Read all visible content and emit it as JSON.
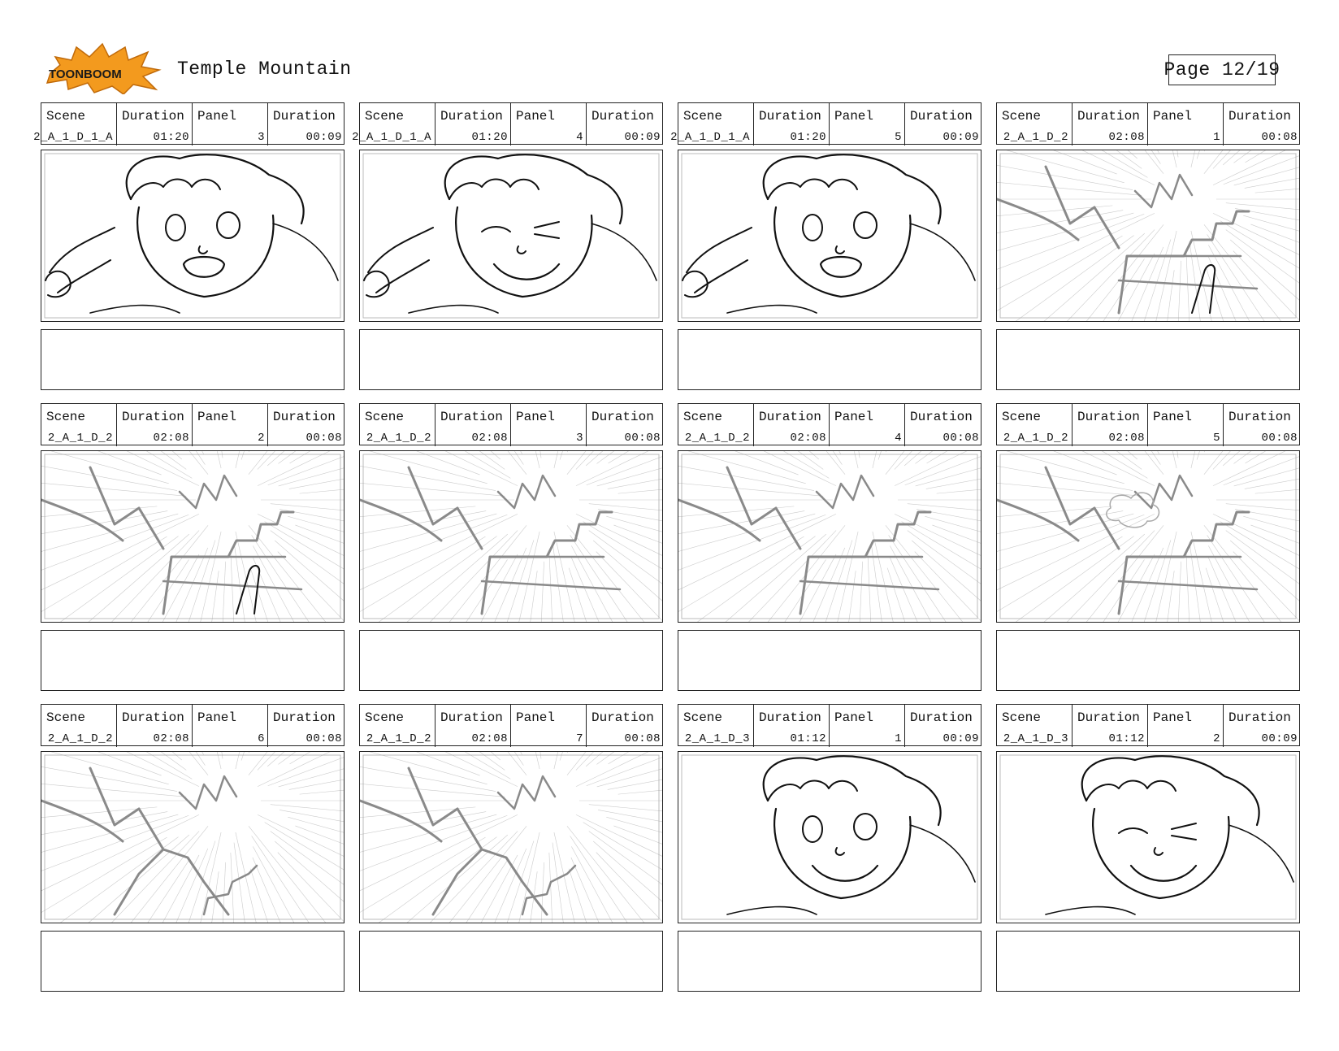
{
  "header": {
    "logo_text": "TOONBOOM",
    "title": "Temple Mountain",
    "page_label": "Page",
    "page_number": "12/19"
  },
  "labels": {
    "scene": "Scene",
    "duration": "Duration",
    "panel": "Panel"
  },
  "panels": [
    {
      "scene": "2_A_1_D_1_A",
      "scene_duration": "01:20",
      "panel": "3",
      "panel_duration": "00:09",
      "sketch": "girl-running-face"
    },
    {
      "scene": "2_A_1_D_1_A",
      "scene_duration": "01:20",
      "panel": "4",
      "panel_duration": "00:09",
      "sketch": "girl-determined-face"
    },
    {
      "scene": "2_A_1_D_1_A",
      "scene_duration": "01:20",
      "panel": "5",
      "panel_duration": "00:09",
      "sketch": "girl-shouting-face"
    },
    {
      "scene": "2_A_1_D_2",
      "scene_duration": "02:08",
      "panel": "1",
      "panel_duration": "00:08",
      "sketch": "temple-mountain-pointing"
    },
    {
      "scene": "2_A_1_D_2",
      "scene_duration": "02:08",
      "panel": "2",
      "panel_duration": "00:08",
      "sketch": "temple-mountain-pointing"
    },
    {
      "scene": "2_A_1_D_2",
      "scene_duration": "02:08",
      "panel": "3",
      "panel_duration": "00:08",
      "sketch": "temple-mountain"
    },
    {
      "scene": "2_A_1_D_2",
      "scene_duration": "02:08",
      "panel": "4",
      "panel_duration": "00:08",
      "sketch": "temple-mountain"
    },
    {
      "scene": "2_A_1_D_2",
      "scene_duration": "02:08",
      "panel": "5",
      "panel_duration": "00:08",
      "sketch": "temple-mountain-far"
    },
    {
      "scene": "2_A_1_D_2",
      "scene_duration": "02:08",
      "panel": "6",
      "panel_duration": "00:08",
      "sketch": "temple-cliff"
    },
    {
      "scene": "2_A_1_D_2",
      "scene_duration": "02:08",
      "panel": "7",
      "panel_duration": "00:08",
      "sketch": "temple-cliff"
    },
    {
      "scene": "2_A_1_D_3",
      "scene_duration": "01:12",
      "panel": "1",
      "panel_duration": "00:09",
      "sketch": "girl-smiling-face"
    },
    {
      "scene": "2_A_1_D_3",
      "scene_duration": "01:12",
      "panel": "2",
      "panel_duration": "00:09",
      "sketch": "girl-winking-face"
    }
  ],
  "colors": {
    "logo_orange": "#f39a1e",
    "logo_dark": "#1a1a1a",
    "sketch_line": "#111111",
    "sketch_gray": "#8a8a8a"
  }
}
